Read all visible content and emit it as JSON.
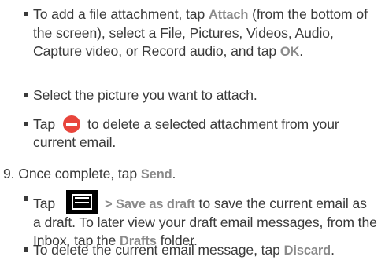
{
  "bullets_top": [
    {
      "text_before": "To add a file attachment, tap ",
      "ui_1": "Attach",
      "text_middle": " (from the bottom of the screen), select a File, Pictures, Videos, Audio, Capture video, or Record audio, and tap ",
      "ui_2": "OK",
      "text_after": "."
    },
    {
      "text": "Select the picture you want to attach."
    },
    {
      "text_before": "Tap",
      "icon": "remove-icon",
      "text_after": "to delete a selected attachment from your current email."
    }
  ],
  "step9": {
    "number": "9.",
    "text_before": "Once complete, tap ",
    "ui": "Send",
    "text_after": "."
  },
  "bullets_bottom": [
    {
      "text_before": "Tap",
      "icon": "menu-icon",
      "ui_prefix": "> ",
      "ui": "Save as draft",
      "text_middle": " to save the current email as a draft. To later view your draft email messages, from the Inbox, tap the ",
      "ui_2": "Drafts",
      "text_after": " folder."
    },
    {
      "text_before": "To delete the current email message, tap ",
      "ui": "Discard",
      "text_after": "."
    }
  ],
  "colors": {
    "text": "#3a3a3a",
    "ui_label": "#8a8a8a",
    "remove_icon": "#e8453c",
    "menu_icon": "#000000"
  }
}
